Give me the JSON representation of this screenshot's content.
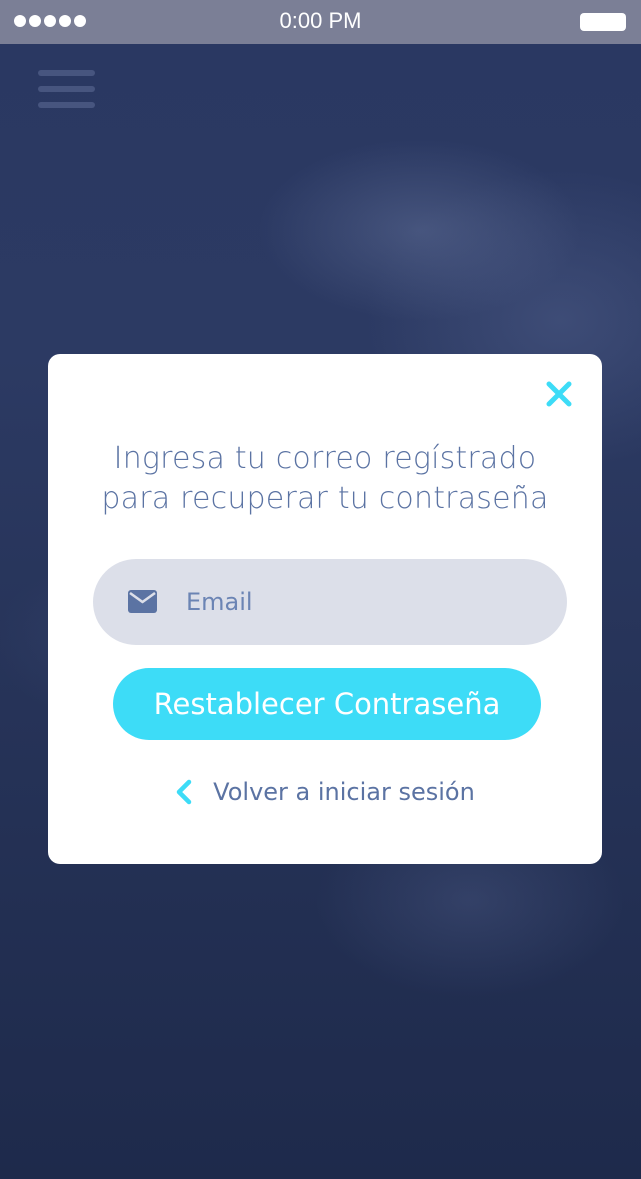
{
  "status_bar": {
    "time": "0:00 PM",
    "signal_icon": "signal-dots-icon",
    "battery_icon": "battery-icon"
  },
  "header": {
    "menu_icon": "hamburger-menu-icon"
  },
  "modal": {
    "close_icon": "close-icon",
    "title_line1": "Ingresa tu correo regístrado",
    "title_line2": "para recuperar tu contraseña",
    "email": {
      "icon": "mail-icon",
      "placeholder": "Email",
      "value": ""
    },
    "reset_button_label": "Restablecer Contraseña",
    "back_link": {
      "icon": "chevron-left-icon",
      "label": "Volver a iniciar sesión"
    }
  },
  "colors": {
    "accent": "#3ddcf7",
    "text": "#5b73a3",
    "input_bg": "#dcdfe9",
    "background": "#2a3862",
    "status_bar": "#7b7f96"
  }
}
